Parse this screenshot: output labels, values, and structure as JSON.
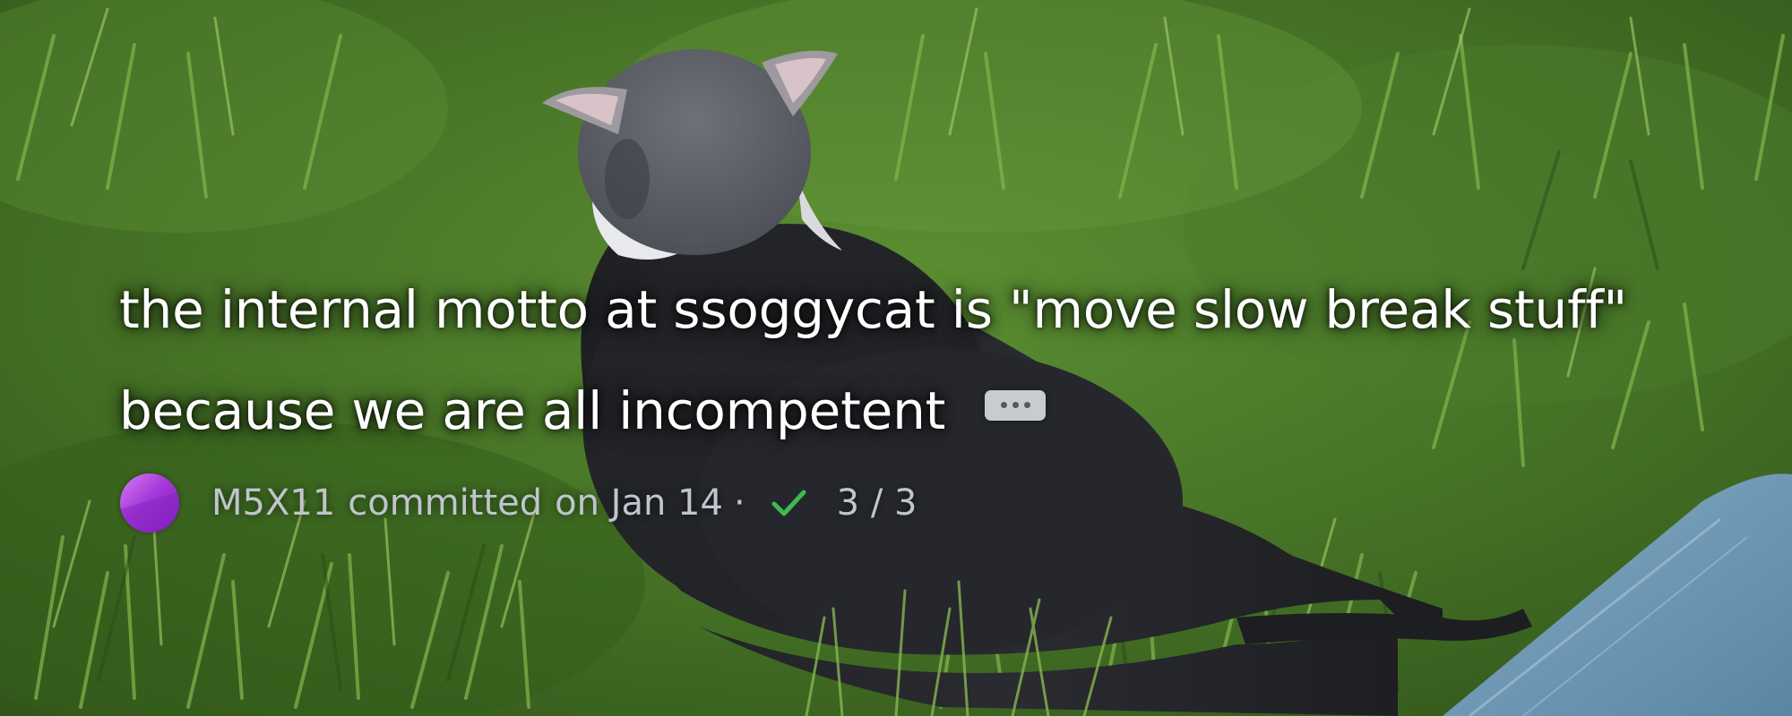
{
  "commit": {
    "message_line1": "the internal motto at ssoggycat is \"move slow break stuff\"",
    "message_line2": "because we are all incompetent",
    "author": "M5X11",
    "action": "committed",
    "date": "on Jan 14",
    "separator": "·",
    "status_count": "3 / 3"
  },
  "icons": {
    "more": "ellipsis-icon",
    "check": "check-icon",
    "avatar": "author-avatar"
  },
  "colors": {
    "avatar_purple": "#a43ad8",
    "check_green": "#3fb950",
    "meta_text": "#bfc5cc",
    "message_text": "#ffffff"
  }
}
